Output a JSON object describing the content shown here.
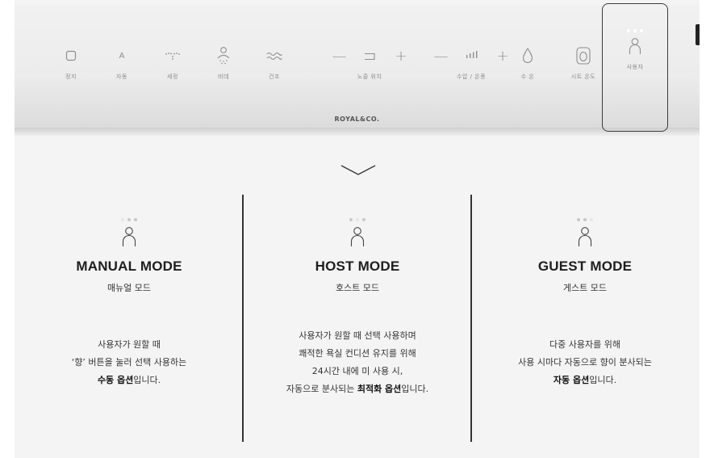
{
  "panel": {
    "brand": "ROYAL&CO.",
    "controls": [
      {
        "key": "stop",
        "label": "정지",
        "icon": "stop-icon"
      },
      {
        "key": "auto",
        "label": "자동",
        "icon": "auto-letter-icon",
        "glyph": "A"
      },
      {
        "key": "wash",
        "label": "세정",
        "icon": "wash-spray-icon"
      },
      {
        "key": "bidet",
        "label": "비데",
        "icon": "bidet-person-icon"
      },
      {
        "key": "dry",
        "label": "건조",
        "icon": "dry-waves-icon"
      },
      {
        "key": "temp",
        "label": "수 온",
        "icon": "water-drop-icon"
      },
      {
        "key": "seat",
        "label": "시트 온도",
        "icon": "seat-icon"
      },
      {
        "key": "user",
        "label": "사용자",
        "icon": "user-icon"
      }
    ],
    "nozzle": {
      "label": "노즐 위치",
      "minus": "—",
      "plus": "+"
    },
    "pressure": {
      "label": "수압 / 온풍",
      "minus": "—",
      "plus": "+"
    }
  },
  "modes": [
    {
      "title": "MANUAL MODE",
      "subtitle": "매뉴얼 모드",
      "active_dot": 1,
      "lines": [
        [
          "사용자가 원할 때"
        ],
        [
          "‘향’ 버튼을 눌러 선택 사용하는"
        ],
        [
          {
            "b": "수동 옵션"
          },
          "입니다."
        ]
      ]
    },
    {
      "title": "HOST MODE",
      "subtitle": "호스트 모드",
      "active_dot": 2,
      "lines": [
        [
          "사용자가 원할 때 선택 사용하며"
        ],
        [
          "쾌적한 욕실 컨디션 유지를 위해"
        ],
        [
          "24시간 내에 미 사용 시,"
        ],
        [
          "자동으로 분사되는 ",
          {
            "b": "최적화 옵션"
          },
          "입니다."
        ]
      ]
    },
    {
      "title": "GUEST MODE",
      "subtitle": "게스트 모드",
      "active_dot": 3,
      "lines": [
        [
          "다중 사용자를 위해"
        ],
        [
          "사용 시마다 자동으로 향이 분사되는"
        ],
        [
          {
            "b": "자동 옵션"
          },
          "입니다."
        ]
      ]
    }
  ]
}
